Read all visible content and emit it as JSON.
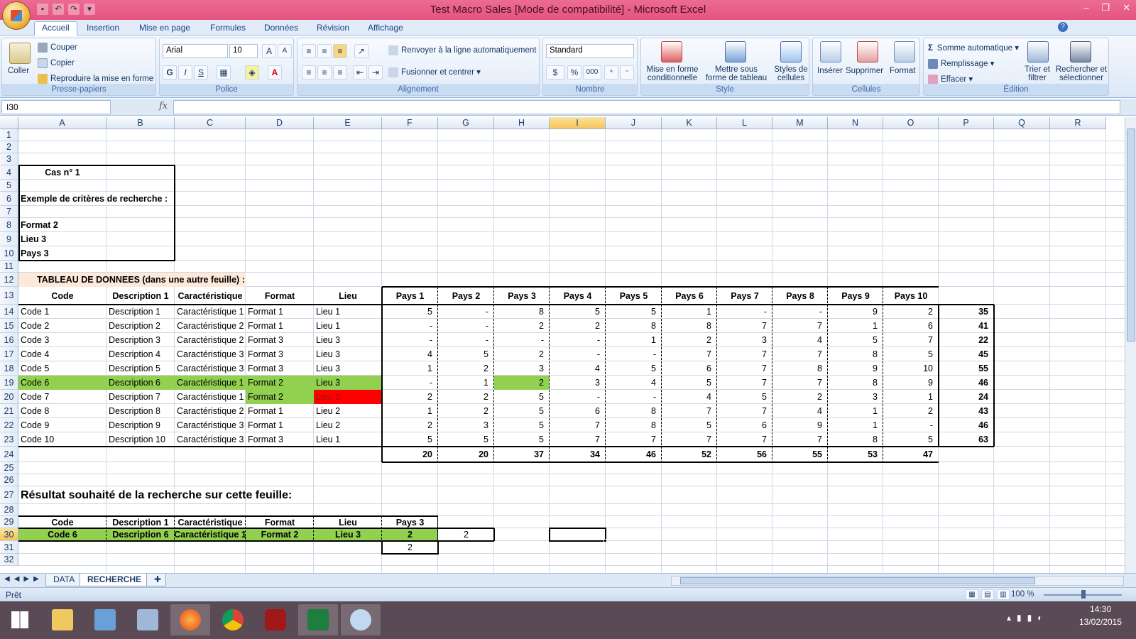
{
  "window": {
    "title": "Test Macro Sales  [Mode de compatibilité] - Microsoft Excel"
  },
  "tabs": [
    "Accueil",
    "Insertion",
    "Mise en page",
    "Formules",
    "Données",
    "Révision",
    "Affichage"
  ],
  "ribbon": {
    "clipboard": {
      "label": "Presse-papiers",
      "paste": "Coller",
      "cut": "Couper",
      "copy": "Copier",
      "format_painter": "Reproduire la mise en forme"
    },
    "font": {
      "label": "Police",
      "name": "Arial",
      "size": "10",
      "bold": "G",
      "italic": "I",
      "underline": "S"
    },
    "alignment": {
      "label": "Alignement",
      "wrap": "Renvoyer à la ligne automatiquement",
      "merge": "Fusionner et centrer"
    },
    "number": {
      "label": "Nombre",
      "format": "Standard",
      "percent": "%",
      "thousands": "000"
    },
    "style": {
      "label": "Style",
      "conditional": "Mise en forme conditionnelle",
      "table": "Mettre sous forme de tableau",
      "cell_styles": "Styles de cellules"
    },
    "cells": {
      "label": "Cellules",
      "insert": "Insérer",
      "delete": "Supprimer",
      "format": "Format"
    },
    "editing": {
      "label": "Édition",
      "autosum": "Somme automatique",
      "fill": "Remplissage",
      "clear": "Effacer",
      "sort": "Trier et filtrer",
      "find": "Rechercher et sélectionner"
    }
  },
  "formula_bar": {
    "name_box": "I30",
    "fx": "fx",
    "formula": ""
  },
  "columns": [
    "A",
    "B",
    "C",
    "D",
    "E",
    "F",
    "G",
    "H",
    "I",
    "J",
    "K",
    "L",
    "M",
    "N",
    "O",
    "P",
    "Q",
    "R"
  ],
  "selected_column": "I",
  "rows": [
    "1",
    "2",
    "3",
    "4",
    "5",
    "6",
    "7",
    "8",
    "9",
    "10",
    "11",
    "12",
    "13",
    "14",
    "15",
    "16",
    "17",
    "18",
    "19",
    "20",
    "21",
    "22",
    "23",
    "24",
    "25",
    "26",
    "27",
    "28",
    "29",
    "30",
    "31",
    "32"
  ],
  "selected_row": "30",
  "criteria": {
    "case": "Cas n° 1",
    "title": "Exemple de critères de recherche :",
    "c1": "Format 2",
    "c2": "Lieu 3",
    "c3": "Pays 3"
  },
  "data_title": "TABLEAU DE DONNEES (dans une autre feuille) :",
  "headers": [
    "Code",
    "Description 1",
    "Caractéristique",
    "Format",
    "Lieu",
    "Pays 1",
    "Pays 2",
    "Pays 3",
    "Pays 4",
    "Pays 5",
    "Pays 6",
    "Pays 7",
    "Pays 8",
    "Pays 9",
    "Pays 10"
  ],
  "data_rows": [
    [
      "Code 1",
      "Description 1",
      "Caractéristique 1",
      "Format 1",
      "Lieu 1",
      "5",
      "-",
      "8",
      "5",
      "5",
      "1",
      "-",
      "-",
      "9",
      "2",
      "35"
    ],
    [
      "Code 2",
      "Description 2",
      "Caractéristique 2",
      "Format 1",
      "Lieu 1",
      "-",
      "-",
      "2",
      "2",
      "8",
      "8",
      "7",
      "7",
      "1",
      "6",
      "41"
    ],
    [
      "Code 3",
      "Description 3",
      "Caractéristique 2",
      "Format 3",
      "Lieu 3",
      "-",
      "-",
      "-",
      "-",
      "1",
      "2",
      "3",
      "4",
      "5",
      "7",
      "22"
    ],
    [
      "Code 4",
      "Description 4",
      "Caractéristique 3",
      "Format 3",
      "Lieu 3",
      "4",
      "5",
      "2",
      "-",
      "-",
      "7",
      "7",
      "7",
      "8",
      "5",
      "45"
    ],
    [
      "Code 5",
      "Description 5",
      "Caractéristique 3",
      "Format 3",
      "Lieu 3",
      "1",
      "2",
      "3",
      "4",
      "5",
      "6",
      "7",
      "8",
      "9",
      "10",
      "55"
    ],
    [
      "Code 6",
      "Description 6",
      "Caractéristique 1",
      "Format 2",
      "Lieu 3",
      "-",
      "1",
      "2",
      "3",
      "4",
      "5",
      "7",
      "7",
      "8",
      "9",
      "46"
    ],
    [
      "Code 7",
      "Description 7",
      "Caractéristique 1",
      "Format 2",
      "Lieu 2",
      "2",
      "2",
      "5",
      "-",
      "-",
      "4",
      "5",
      "2",
      "3",
      "1",
      "24"
    ],
    [
      "Code 8",
      "Description 8",
      "Caractéristique 2",
      "Format 1",
      "Lieu 2",
      "1",
      "2",
      "5",
      "6",
      "8",
      "7",
      "7",
      "4",
      "1",
      "2",
      "43"
    ],
    [
      "Code 9",
      "Description 9",
      "Caractéristique 3",
      "Format 1",
      "Lieu 2",
      "2",
      "3",
      "5",
      "7",
      "8",
      "5",
      "6",
      "9",
      "1",
      "-",
      "46"
    ],
    [
      "Code 10",
      "Description 10",
      "Caractéristique 3",
      "Format 3",
      "Lieu 1",
      "5",
      "5",
      "5",
      "7",
      "7",
      "7",
      "7",
      "7",
      "8",
      "5",
      "63"
    ]
  ],
  "totals": [
    "20",
    "20",
    "37",
    "34",
    "46",
    "52",
    "56",
    "55",
    "53",
    "47"
  ],
  "result_title": "Résultat souhaité de la recherche sur cette feuille:",
  "result_headers": [
    "Code",
    "Description 1",
    "Caractéristique",
    "Format",
    "Lieu",
    "Pays 3"
  ],
  "result_row": [
    "Code 6",
    "Description 6",
    "Caractéristique 1",
    "Format 2",
    "Lieu 3",
    "2"
  ],
  "result_extra_g30": "2",
  "result_f31": "2",
  "sheets": [
    "DATA",
    "RECHERCHE"
  ],
  "active_sheet": "RECHERCHE",
  "status": {
    "ready": "Prêt",
    "zoom": "100 %"
  },
  "taskbar": {
    "time": "14:30",
    "date": "13/02/2015"
  },
  "colors": {
    "green": "#92d050",
    "red": "#ff0000",
    "peach": "#fde9d9",
    "title_bar": "#e4547f"
  }
}
